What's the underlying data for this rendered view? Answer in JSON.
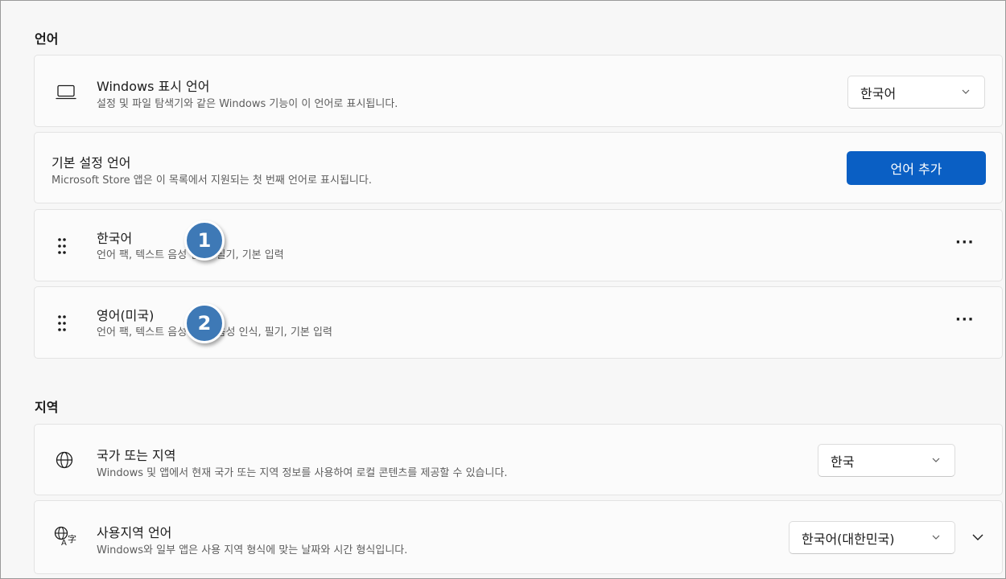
{
  "language_section": {
    "title": "언어",
    "display_language": {
      "title": "Windows 표시 언어",
      "description": "설정 및 파일 탐색기와 같은 Windows 기능이 이 언어로 표시됩니다.",
      "selected": "한국어",
      "icon": "laptop-icon"
    },
    "preferred_languages": {
      "title": "기본 설정 언어",
      "description": "Microsoft Store 앱은 이 목록에서 지원되는 첫 번째 언어로 표시됩니다.",
      "add_button": "언어 추가"
    },
    "languages": [
      {
        "name": "한국어",
        "features": "언어 팩, 텍스트 음성 변환, 필기, 기본 입력"
      },
      {
        "name": "영어(미국)",
        "features": "언어 팩, 텍스트 음성 변환, 음성 인식, 필기, 기본 입력"
      }
    ],
    "more_label": "···"
  },
  "region_section": {
    "title": "지역",
    "country": {
      "title": "국가 또는 지역",
      "description": "Windows 및 앱에서 현재 국가 또는 지역 정보를 사용하여 로컬 콘텐츠를 제공할 수 있습니다.",
      "selected": "한국",
      "icon": "globe-icon"
    },
    "regional_format": {
      "title": "사용지역 언어",
      "description": "Windows와 일부 앱은 사용 지역 형식에 맞는 날짜와 시간 형식입니다.",
      "selected": "한국어(대한민국)",
      "icon": "language-format-icon"
    }
  },
  "annotations": [
    "1",
    "2"
  ],
  "colors": {
    "accent": "#0a5fc4",
    "badge": "#3e79b6",
    "background": "#f7f7f7",
    "card": "#fbfbfb"
  }
}
